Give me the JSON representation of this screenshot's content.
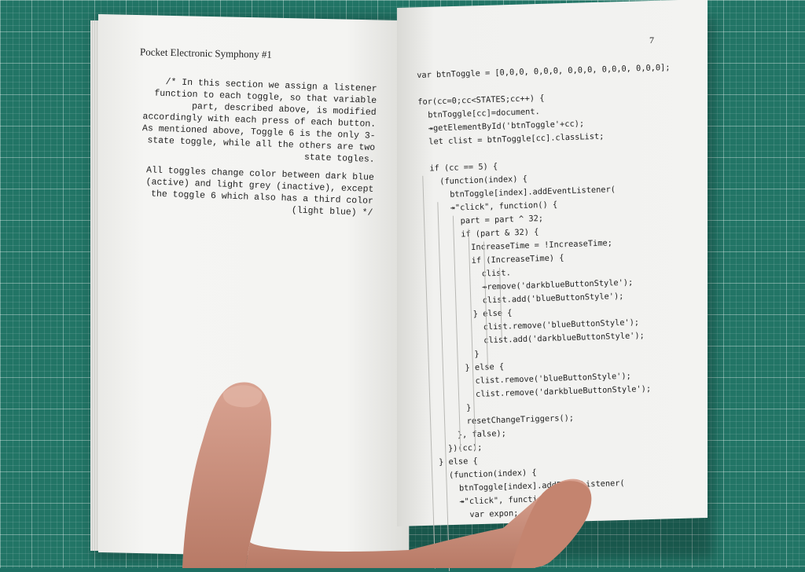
{
  "photo": {
    "subject": "open-booklet-held-in-hand",
    "colors": {
      "mat": "#227566",
      "paper": "#f3f3f1",
      "ink": "#222222",
      "skin": "#c98f7c"
    }
  },
  "left_page": {
    "running_head": "Pocket Electronic Symphony #1",
    "comment_paragraphs": [
      "/* In this section we assign a listener function to each toggle, so that variable part, described above, is modified accordingly with each press of each button. As mentioned above, Toggle 6 is the only 3-state toggle, while all the others are two state togles.",
      "All toggles change color between dark blue (active) and light grey (inactive), except the toggle 6 which also has a third color (light blue) */"
    ]
  },
  "right_page": {
    "page_number": "7",
    "code_lines": [
      "var btnToggle = [0,0,0, 0,0,0, 0,0,0, 0,0,0, 0,0,0];",
      "",
      "for(cc=0;cc<STATES;cc++) {",
      "  btnToggle[cc]=document.",
      "  ↠getElementById('btnToggle'+cc);",
      "  let clist = btnToggle[cc].classList;",
      "",
      "  if (cc == 5) {",
      "    (function(index) {",
      "      btnToggle[index].addEventListener(",
      "      ↠\"click\", function() {",
      "        part = part ^ 32;",
      "        if (part & 32) {",
      "          IncreaseTime = !IncreaseTime;",
      "          if (IncreaseTime) {",
      "            clist.",
      "            ↠remove('darkblueButtonStyle');",
      "            clist.add('blueButtonStyle');",
      "          } else {",
      "            clist.remove('blueButtonStyle');",
      "            clist.add('darkblueButtonStyle');",
      "          }",
      "        } else {",
      "          clist.remove('blueButtonStyle');",
      "          clist.remove('darkblueButtonStyle');",
      "        }",
      "        resetChangeTriggers();",
      "      }, false);",
      "    })(cc);",
      "  } else {",
      "    (function(index) {",
      "      btnToggle[index].addEventListener(",
      "      ↠\"click\", function() {",
      "        var expon;"
    ]
  }
}
